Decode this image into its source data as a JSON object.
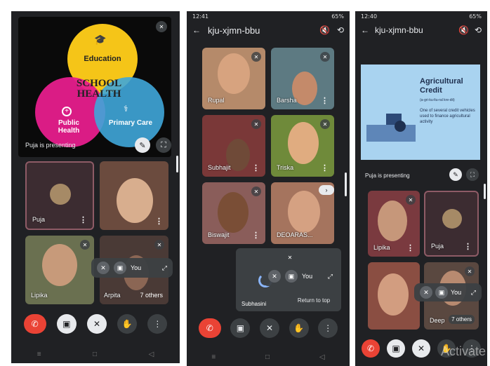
{
  "phone1": {
    "presenting_label": "Puja is presenting",
    "slide": {
      "circle_top": "Education",
      "center_text": "SCHOOL HEALTH",
      "circle_left": "Public Health",
      "circle_right": "Primary Care"
    },
    "tiles": [
      {
        "name": "Puja"
      },
      {
        "name": ""
      },
      {
        "name": "Lipika"
      },
      {
        "name": "Arpita"
      }
    ],
    "others_label": "7 others",
    "you_label": "You"
  },
  "phone2": {
    "status_time": "12:41",
    "status_right": "65%",
    "meeting_code": "kju-xjmn-bbu",
    "tiles": [
      {
        "name": "Rupal"
      },
      {
        "name": "Barsha"
      },
      {
        "name": "Subhajit"
      },
      {
        "name": "Triska"
      },
      {
        "name": "Biswajit"
      },
      {
        "name": "DEOARAS..."
      }
    ],
    "self_name": "Subhasini",
    "you_label": "You",
    "return_to_top": "Return to top"
  },
  "phone3": {
    "status_time": "12:40",
    "status_right": "65%",
    "meeting_code": "kju-xjmn-bbu",
    "presenting_label": "Puja is presenting",
    "slide": {
      "title": "Agricultural Credit",
      "phonetic": "(a-gri-ku-ltu-ral kre-dit)",
      "body": "One of several credit vehicles used to finance agricultural activity"
    },
    "tiles": [
      {
        "name": "Lipika"
      },
      {
        "name": "Puja"
      },
      {
        "name": ""
      },
      {
        "name": "Deep"
      }
    ],
    "others_label": "7 others",
    "you_label": "You"
  },
  "watermark": "Activate",
  "colors": {
    "bg": "#202124",
    "end_call": "#ea4335",
    "tile_border": "#8e5b66"
  }
}
